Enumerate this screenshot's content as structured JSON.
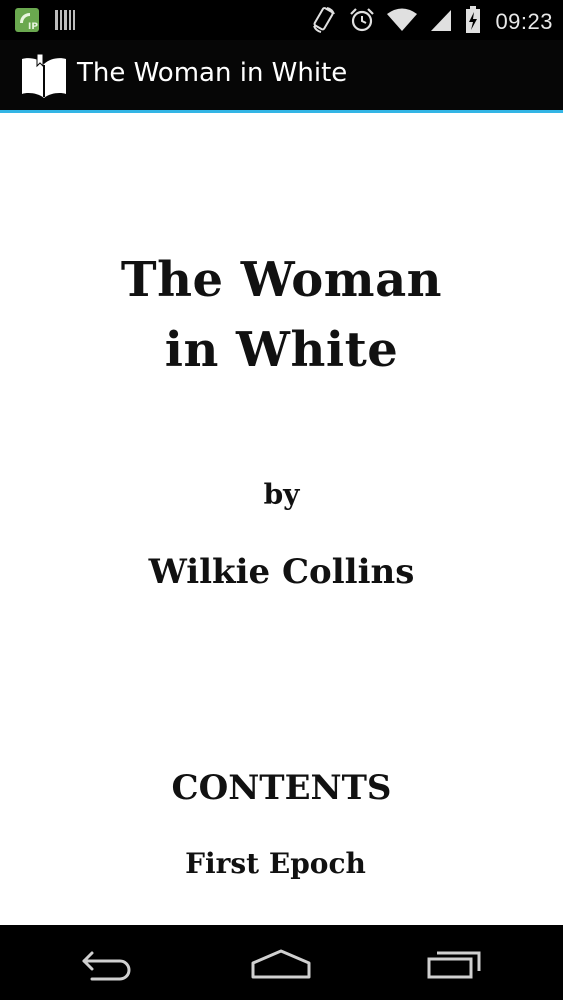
{
  "status_bar": {
    "time": "09:23",
    "left_icons": [
      "sip-call-icon",
      "barcode-icon"
    ],
    "right_icons": [
      "rotate-icon",
      "alarm-icon",
      "wifi-icon",
      "signal-icon",
      "battery-charging-icon"
    ]
  },
  "action_bar": {
    "title": "The Woman in White",
    "icon": "open-book-icon"
  },
  "content": {
    "title_line1": "The Woman",
    "title_line2": "in White",
    "by": "by",
    "author": "Wilkie Collins",
    "contents_heading": "CONTENTS",
    "first_section": "First Epoch"
  },
  "nav_bar": {
    "buttons": [
      "back-icon",
      "home-icon",
      "recents-icon"
    ]
  },
  "colors": {
    "accent": "#33b5e5",
    "bar_background": "#000000",
    "content_background": "#ffffff",
    "text": "#111111"
  }
}
